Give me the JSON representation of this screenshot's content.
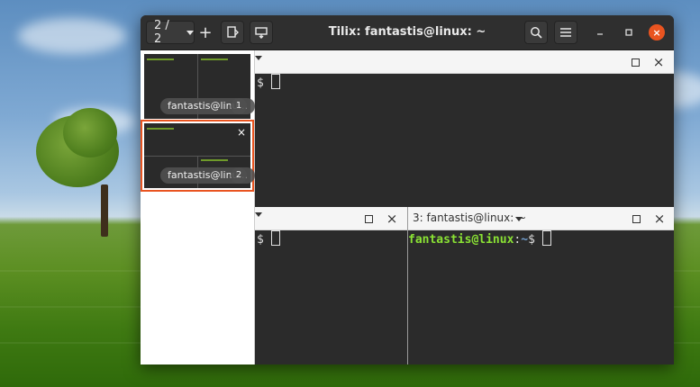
{
  "window": {
    "title": "Tilix: fantastis@linux: ~",
    "session_switcher": "2 / 2",
    "accent_color": "#e95420"
  },
  "toolbar": {
    "add_icon": "plus-icon",
    "new_session_icon": "add-session-icon",
    "detach_icon": "detach-icon",
    "search_icon": "search-icon",
    "menu_icon": "hamburger-icon"
  },
  "sidebar": {
    "sessions": [
      {
        "label": "fantastis@linu...",
        "number": "1"
      },
      {
        "label": "fantastis@linu...",
        "number": "2"
      }
    ]
  },
  "panes": {
    "top_left": {
      "prompt_suffix": "$"
    },
    "bottom_left": {
      "prompt_suffix": "$"
    },
    "bottom_right": {
      "title": "3: fantastis@linux: ~",
      "prompt_user": "fantastis@linux",
      "prompt_sep": ":",
      "prompt_path": "~",
      "prompt_suffix": "$"
    }
  },
  "glyphs": {
    "plus": "+",
    "close": "×",
    "minimize": "—"
  }
}
